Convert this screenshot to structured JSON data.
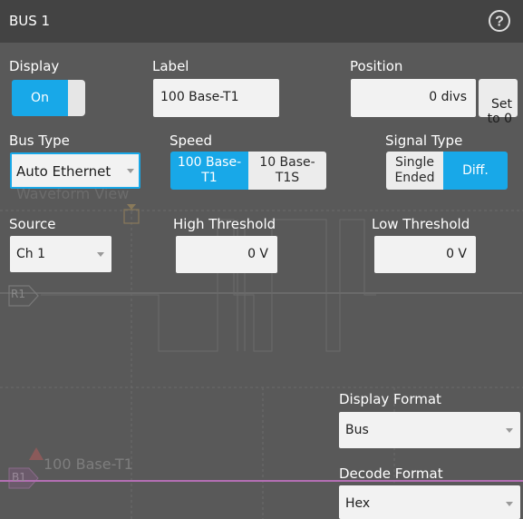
{
  "window": {
    "title": "BUS 1",
    "help_icon": "question-circle-icon"
  },
  "display": {
    "label": "Display",
    "toggle_value": "On"
  },
  "label_field": {
    "label": "Label",
    "value": "100 Base-T1"
  },
  "position": {
    "label": "Position",
    "value": "0 divs",
    "set_button": "Set\nto 0"
  },
  "bus_type": {
    "label": "Bus Type",
    "value": "Auto Ethernet"
  },
  "speed": {
    "label": "Speed",
    "options": [
      "100 Base-\nT1",
      "10 Base-\nT1S"
    ],
    "selected": "100 Base-\nT1"
  },
  "signal_type": {
    "label": "Signal Type",
    "options": [
      "Single\nEnded",
      "Diff."
    ],
    "selected": "Diff."
  },
  "source": {
    "label": "Source",
    "value": "Ch 1"
  },
  "high_threshold": {
    "label": "High Threshold",
    "value": "0 V"
  },
  "low_threshold": {
    "label": "Low Threshold",
    "value": "0 V"
  },
  "display_format": {
    "label": "Display Format",
    "value": "Bus"
  },
  "decode_format": {
    "label": "Decode Format",
    "value": "Hex"
  },
  "background": {
    "bus_label": "100 Base-T1",
    "bus_badge": "B1",
    "ref_badge": "R1",
    "ghost_text": "Waveform View",
    "bus_line_color": "#b36fb3"
  },
  "colors": {
    "accent": "#18a8e8",
    "titlebar": "#434343",
    "panel": "#595959"
  }
}
